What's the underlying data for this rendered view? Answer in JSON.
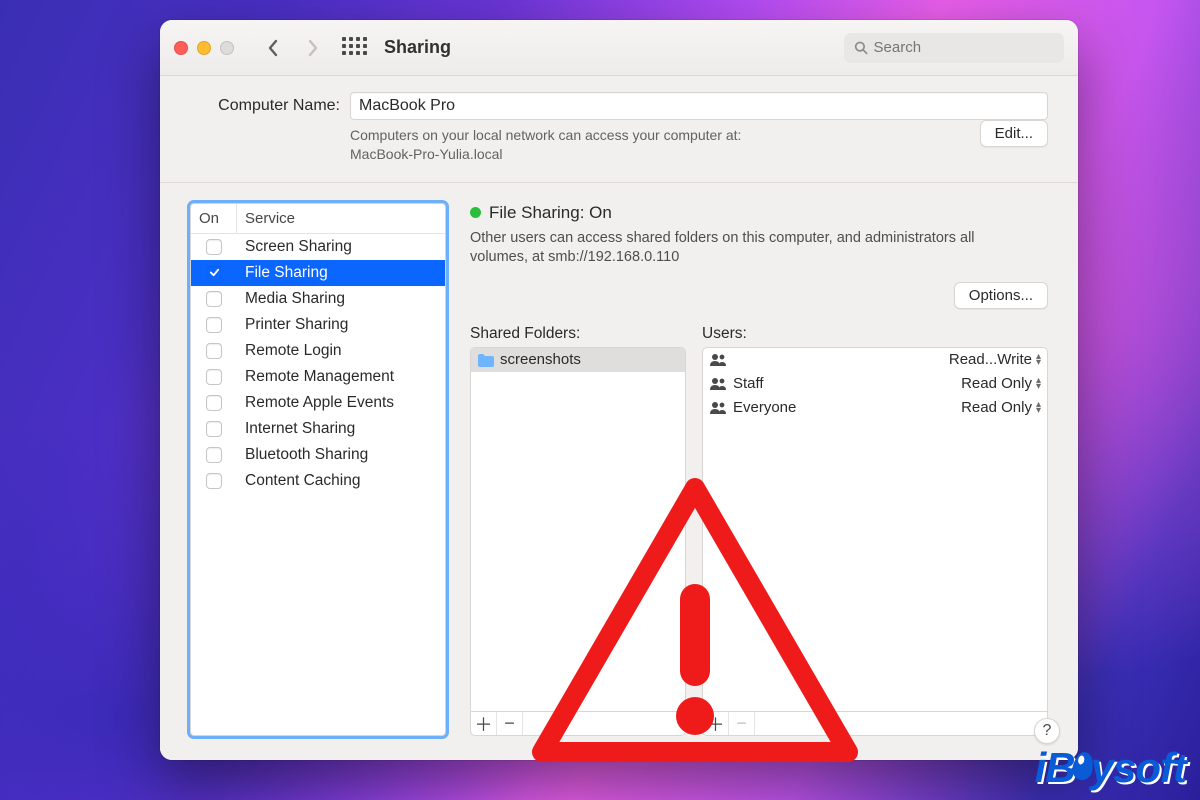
{
  "titlebar": {
    "title": "Sharing",
    "search_placeholder": "Search"
  },
  "header": {
    "computer_name_label": "Computer Name:",
    "computer_name_value": "MacBook Pro",
    "note_line1": "Computers on your local network can access your computer at:",
    "note_line2": "MacBook-Pro-Yulia.local",
    "edit_label": "Edit..."
  },
  "services": {
    "head_on": "On",
    "head_service": "Service",
    "items": [
      {
        "label": "Screen Sharing",
        "on": false,
        "selected": false
      },
      {
        "label": "File Sharing",
        "on": true,
        "selected": true
      },
      {
        "label": "Media Sharing",
        "on": false,
        "selected": false
      },
      {
        "label": "Printer Sharing",
        "on": false,
        "selected": false
      },
      {
        "label": "Remote Login",
        "on": false,
        "selected": false
      },
      {
        "label": "Remote Management",
        "on": false,
        "selected": false
      },
      {
        "label": "Remote Apple Events",
        "on": false,
        "selected": false
      },
      {
        "label": "Internet Sharing",
        "on": false,
        "selected": false
      },
      {
        "label": "Bluetooth Sharing",
        "on": false,
        "selected": false
      },
      {
        "label": "Content Caching",
        "on": false,
        "selected": false
      }
    ]
  },
  "detail": {
    "status_title": "File Sharing: On",
    "status_desc": "Other users can access shared folders on this computer, and administrators all volumes, at smb://192.168.0.110",
    "options_label": "Options...",
    "shared_title": "Shared Folders:",
    "users_title": "Users:",
    "shared_folders": [
      {
        "name": "screenshots",
        "selected": true
      }
    ],
    "users": [
      {
        "name": "",
        "perm": "Read...Write"
      },
      {
        "name": "Staff",
        "perm": "Read Only"
      },
      {
        "name": "Everyone",
        "perm": "Read Only"
      }
    ]
  },
  "branding": {
    "logo_text": "iBoysoft"
  },
  "colors": {
    "accent": "#0a66ff",
    "status_green": "#2bbd3b",
    "warning_red": "#ef1b1b"
  }
}
